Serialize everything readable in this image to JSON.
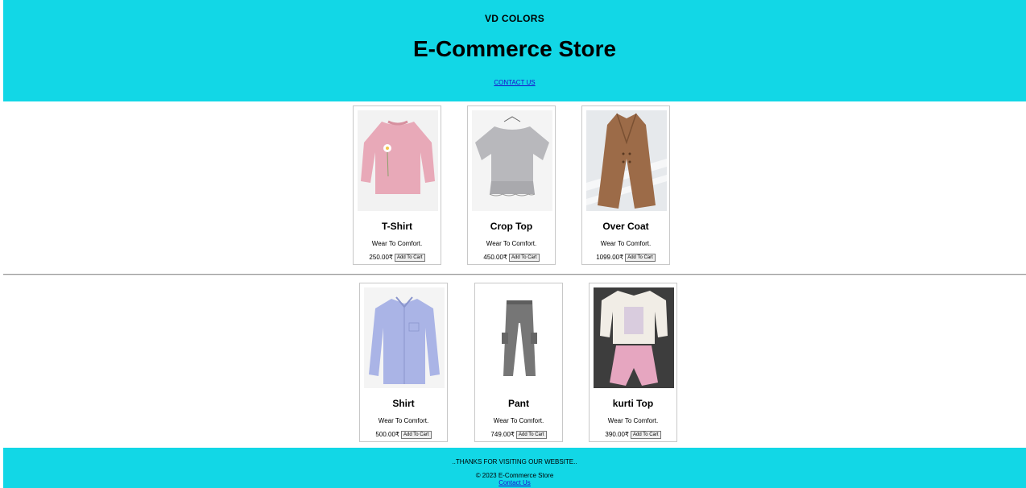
{
  "header": {
    "brand": "VD COLORS",
    "title": "E-Commerce Store",
    "contact_link": "CONTACT US"
  },
  "products": [
    {
      "name": "T-Shirt",
      "description": "Wear To Comfort.",
      "price": "250.00₹",
      "button": "Add To Cart",
      "image_icon": "pink-sweatshirt-image"
    },
    {
      "name": "Crop Top",
      "description": "Wear To Comfort.",
      "price": "450.00₹",
      "button": "Add To Cart",
      "image_icon": "grey-crop-top-image"
    },
    {
      "name": "Over Coat",
      "description": "Wear To Comfort.",
      "price": "1099.00₹",
      "button": "Add To Cart",
      "image_icon": "brown-overcoat-image"
    },
    {
      "name": "Shirt",
      "description": "Wear To Comfort.",
      "price": "500.00₹",
      "button": "Add To Cart",
      "image_icon": "blue-shirt-image"
    },
    {
      "name": "Pant",
      "description": "Wear To Comfort.",
      "price": "749.00₹",
      "button": "Add To Cart",
      "image_icon": "grey-cargo-pant-image"
    },
    {
      "name": "kurti Top",
      "description": "Wear To Comfort.",
      "price": "390.00₹",
      "button": "Add To Cart",
      "image_icon": "kurti-set-image"
    }
  ],
  "footer": {
    "thanks": "..THANKS FOR VISITING OUR WEBSITE..",
    "copyright": "© 2023 E-Commerce Store",
    "contact_link": "Contact Us"
  },
  "colors": {
    "banner": "#12d7e6",
    "link": "#1a0dcc"
  }
}
